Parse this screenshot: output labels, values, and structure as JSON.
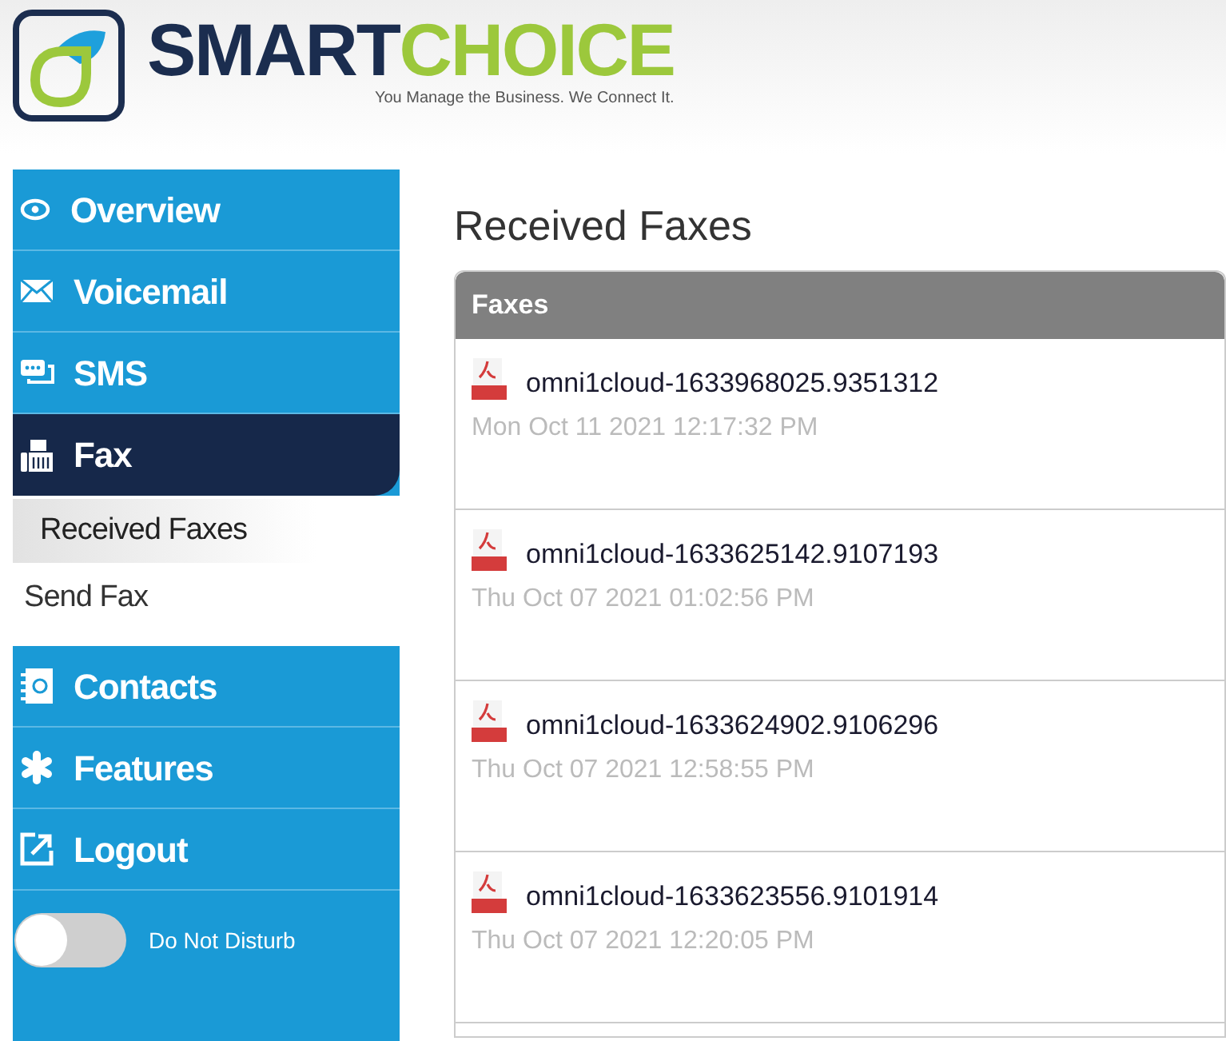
{
  "brand": {
    "name_parts": [
      "SMART",
      "CHOICE"
    ],
    "tagline": "You Manage the Business. We Connect It."
  },
  "sidebar": {
    "items": [
      {
        "label": "Overview",
        "selected": false
      },
      {
        "label": "Voicemail",
        "selected": false
      },
      {
        "label": "SMS",
        "selected": false
      },
      {
        "label": "Fax",
        "selected": true,
        "children": [
          {
            "label": "Received Faxes",
            "selected": true
          },
          {
            "label": "Send Fax",
            "selected": false
          }
        ]
      },
      {
        "label": "Contacts",
        "selected": false
      },
      {
        "label": "Features",
        "selected": false
      },
      {
        "label": "Logout",
        "selected": false
      }
    ],
    "do_not_disturb": {
      "label": "Do Not Disturb",
      "on": false
    }
  },
  "page_title": "Received Faxes",
  "panel": {
    "title": "Faxes",
    "faxes": [
      {
        "name": "omni1cloud-1633968025.9351312",
        "date": "Mon Oct 11 2021 12:17:32 PM"
      },
      {
        "name": "omni1cloud-1633625142.9107193",
        "date": "Thu Oct 07 2021 01:02:56 PM"
      },
      {
        "name": "omni1cloud-1633624902.9106296",
        "date": "Thu Oct 07 2021 12:58:55 PM"
      },
      {
        "name": "omni1cloud-1633623556.9101914",
        "date": "Thu Oct 07 2021 12:20:05 PM"
      }
    ]
  }
}
